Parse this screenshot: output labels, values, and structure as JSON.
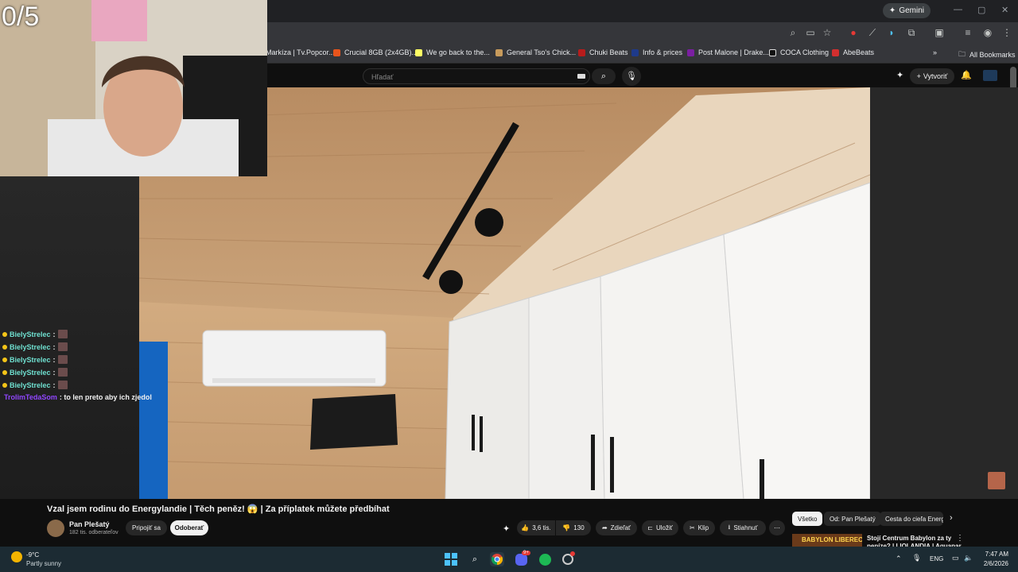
{
  "overlay": {
    "counter": "0/5"
  },
  "chat": [
    {
      "user": "BielyStrelec",
      "text": ":"
    },
    {
      "user": "BielyStrelec",
      "text": ":"
    },
    {
      "user": "BielyStrelec",
      "text": ":"
    },
    {
      "user": "BielyStrelec",
      "text": ":"
    },
    {
      "user": "BielyStrelec",
      "text": ":"
    },
    {
      "user": "TrolimTedaSom",
      "text": ": to len preto aby ich zjedol"
    }
  ],
  "browser": {
    "gemini_label": "Gemini",
    "bookmarks": [
      "Markíza | Tv.Popcor...",
      "Crucial 8GB (2x4GB)...",
      "We go back to the...",
      "General Tso's Chick...",
      "Chuki Beats",
      "Info & prices",
      "Post Malone | Drake...",
      "COCA Clothing",
      "AbeBeats"
    ],
    "all_bookmarks": "All Bookmarks"
  },
  "youtube": {
    "search_placeholder": "Hľadať",
    "create_label": "Vytvoriť",
    "video_title": "Vzal jsem rodinu do Energylandie | Těch peněz! 😱 | Za příplatek můžete předbíhat",
    "channel_name": "Pan Plešatý",
    "subscribers": "182 tis. odberateľov",
    "join_label": "Pripojiť sa",
    "subscribe_label": "Odoberať",
    "like_count": "3,6 tis.",
    "dislike_count": "130",
    "share_label": "Zdieľať",
    "save_label": "Uložiť",
    "clip_label": "Klip",
    "download_label": "Stiahnuť",
    "chips": [
      "Všetko",
      "Od: Pan Plešatý",
      "Cesta do cieľa Energ"
    ],
    "rec_thumb_text": "BABYLON LIBEREC",
    "rec_title": "Stojí Centrum Babylon za ty",
    "rec_title_2": "peníze? | LIOLANDIA | Aquapar"
  },
  "taskbar": {
    "temp": "-9°C",
    "weather": "Partly sunny",
    "lang": "ENG",
    "time": "7:47 AM",
    "date": "2/6/2026",
    "discord_badge": "9+"
  },
  "colors": {
    "accent_gold": "#f5c518",
    "trolim_color": "#9146ff",
    "biely_color": "#6fe0d0"
  }
}
